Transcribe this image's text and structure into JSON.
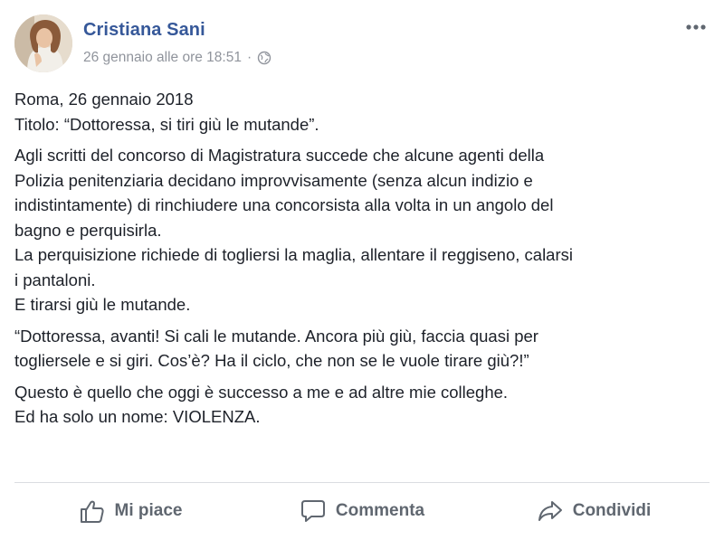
{
  "post": {
    "author": "Cristiana Sani",
    "timestamp": "26 gennaio alle ore 18:51",
    "separator": "·",
    "privacy_icon": "globe-icon",
    "more_icon": "more-dots-icon",
    "paragraphs": [
      "Roma, 26 gennaio 2018\nTitolo: “Dottoressa, si tiri giù le mutande”.",
      "Agli scritti del concorso di Magistratura succede che alcune agenti della\nPolizia penitenziaria decidano improvvisamente (senza alcun indizio e\nindistintamente) di rinchiudere una concorsista alla volta in un angolo del\nbagno e perquisirla.\nLa perquisizione richiede di togliersi la maglia, allentare il reggiseno, calarsi\ni pantaloni.\nE tirarsi giù le mutande.",
      "“Dottoressa, avanti! Si cali le mutande. Ancora più giù, faccia quasi per\ntogliersele e si giri. Cos’è? Ha il ciclo, che non se le vuole tirare giù?!”",
      "Questo è quello che oggi è successo a me e ad altre mie colleghe.\nEd ha solo un nome: VIOLENZA."
    ]
  },
  "actions": {
    "like": {
      "label": "Mi piace",
      "icon": "thumbs-up-icon"
    },
    "comment": {
      "label": "Commenta",
      "icon": "comment-bubble-icon"
    },
    "share": {
      "label": "Condividi",
      "icon": "share-arrow-icon"
    }
  },
  "colors": {
    "author_link": "#365899",
    "meta_text": "#90949c",
    "body_text": "#1d2129",
    "action_text": "#606770",
    "divider": "#dadde1"
  }
}
